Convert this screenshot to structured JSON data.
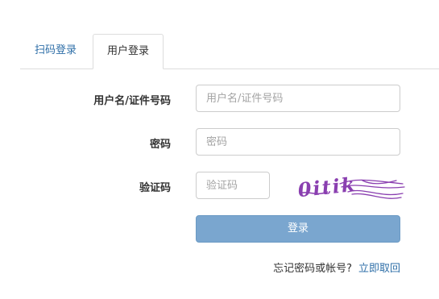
{
  "tabs": [
    {
      "label": "扫码登录",
      "active": false
    },
    {
      "label": "用户登录",
      "active": true
    }
  ],
  "form": {
    "username_label": "用户名/证件号码",
    "username_placeholder": "用户名/证件号码",
    "username_value": "",
    "password_label": "密码",
    "password_placeholder": "密码",
    "password_value": "",
    "captcha_label": "验证码",
    "captcha_placeholder": "验证码",
    "captcha_value": "",
    "captcha_image_text": "0itik",
    "captcha_color": "#8a3fb0",
    "submit_label": "登录",
    "submit_color": "#7aa6cf"
  },
  "footer": {
    "forgot_text": "忘记密码或帐号?",
    "recover_link": "立即取回"
  },
  "colors": {
    "link": "#2f6fa8",
    "border": "#cccccc"
  }
}
